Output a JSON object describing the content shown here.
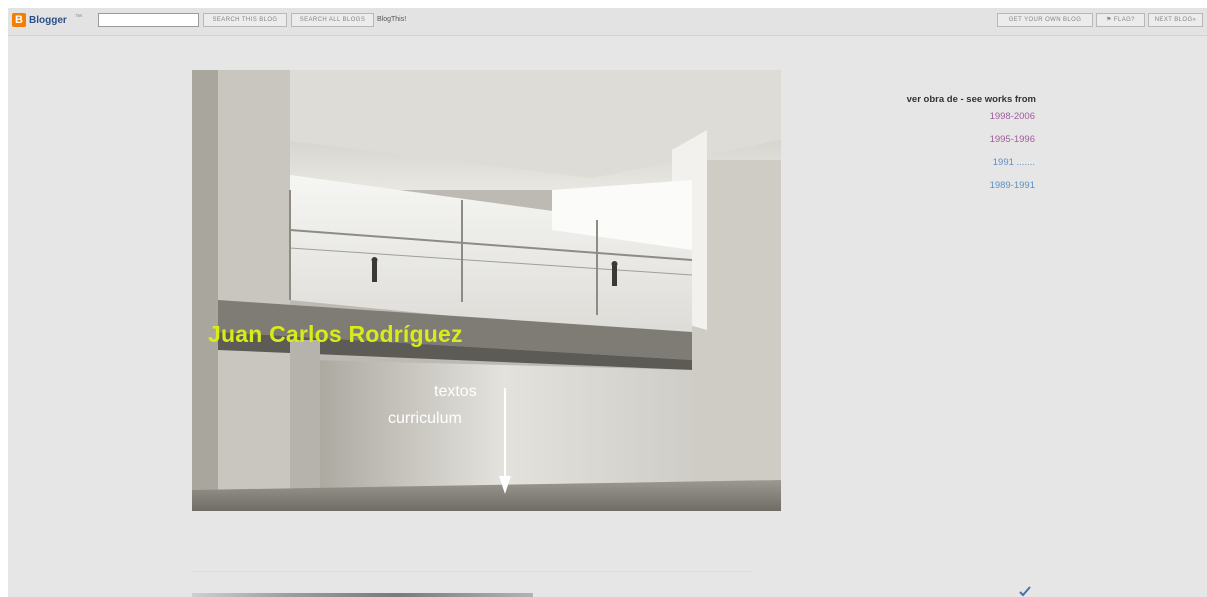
{
  "navbar": {
    "logo_text": "Blogger",
    "logo_tm": "™",
    "logo_mark": "B",
    "search_this_blog": "SEARCH THIS BLOG",
    "search_all_blogs": "SEARCH ALL BLOGS",
    "blog_this": "BlogThis!",
    "get_your_own_blog": "GET YOUR OWN BLOG",
    "flag": "⚑ FLAG?",
    "next_blog": "NEXT BLOG»"
  },
  "hero": {
    "name": "Juan Carlos Rodríguez",
    "textos": "textos",
    "curriculum": "curriculum"
  },
  "sidebar": {
    "title": "ver obra de - see works from",
    "links": [
      {
        "label": "1998-2006",
        "color": "#a05c9c"
      },
      {
        "label": "1995-1996",
        "color": "#a05c9c"
      },
      {
        "label": "1991 .......",
        "color": "#5f8fc0"
      },
      {
        "label": "1989-1991",
        "color": "#5f8fc0"
      }
    ]
  },
  "colors": {
    "accent_name": "#d7ec18",
    "page_bg": "#e6e6e6"
  }
}
